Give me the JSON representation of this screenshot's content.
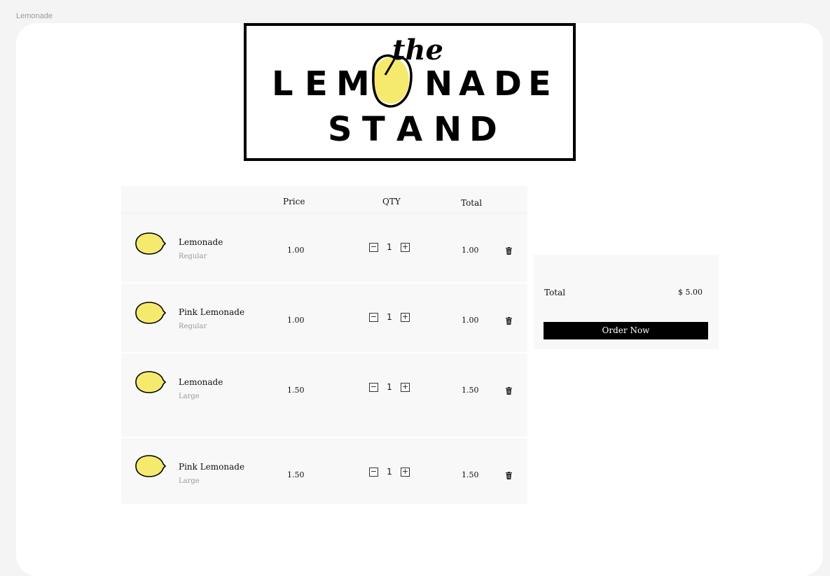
{
  "window": {
    "title": "Lemonade"
  },
  "logo": {
    "the": "the",
    "line1": "LEMONADE",
    "line2": "STAND",
    "lemon_color": "#f5ea6e"
  },
  "cart": {
    "headers": {
      "price": "Price",
      "qty": "QTY",
      "total": "Total"
    },
    "items": [
      {
        "name": "Lemonade",
        "variant": "Regular",
        "price": "1.00",
        "qty": "1",
        "total": "1.00"
      },
      {
        "name": "Pink Lemonade",
        "variant": "Regular",
        "price": "1.00",
        "qty": "1",
        "total": "1.00"
      },
      {
        "name": "Lemonade",
        "variant": "Large",
        "price": "1.50",
        "qty": "1",
        "total": "1.50"
      },
      {
        "name": "Pink Lemonade",
        "variant": "Large",
        "price": "1.50",
        "qty": "1",
        "total": "1.50"
      }
    ],
    "minus_label": "−",
    "plus_label": "+"
  },
  "summary": {
    "total_label": "Total",
    "total_value": "$ 5.00",
    "order_button": "Order Now"
  },
  "icons": {
    "trash": "trash-icon",
    "lemon": "lemon-icon"
  }
}
